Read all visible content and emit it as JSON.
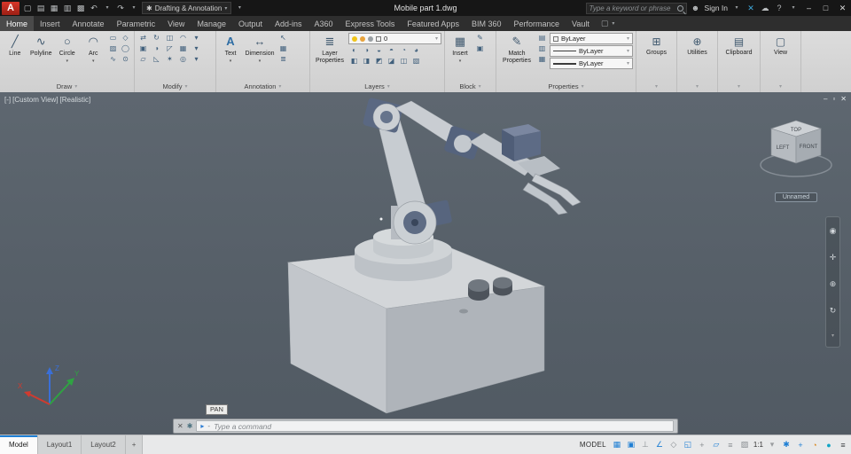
{
  "theme": {
    "titlebar_bg": "#161616",
    "ribbon_bg": "#d5d5d5",
    "viewport_bg": "#59626b",
    "accent_blue": "#1f7fd4",
    "autocad_red": "#c1271b",
    "model_gray": "#c8ccd0",
    "joint_dark": "#5a6880"
  },
  "titlebar": {
    "logo": "A",
    "workspace": "Drafting & Annotation",
    "doc_title": "Mobile part 1.dwg",
    "search_placeholder": "Type a keyword or phrase",
    "sign_in": "Sign In",
    "help": "?"
  },
  "ribbon_tabs": [
    "Home",
    "Insert",
    "Annotate",
    "Parametric",
    "View",
    "Manage",
    "Output",
    "Add-ins",
    "A360",
    "Express Tools",
    "Featured Apps",
    "BIM 360",
    "Performance",
    "Vault"
  ],
  "ribbon": {
    "draw": {
      "label": "Draw",
      "line": "Line",
      "polyline": "Polyline",
      "circle": "Circle",
      "arc": "Arc"
    },
    "modify": {
      "label": "Modify"
    },
    "annotation": {
      "label": "Annotation",
      "text": "Text",
      "dimension": "Dimension"
    },
    "layers": {
      "label": "Layers",
      "layer_properties": "Layer Properties",
      "current_layer": "0"
    },
    "block": {
      "label": "Block",
      "insert": "Insert"
    },
    "properties": {
      "label": "Properties",
      "match": "Match Properties",
      "bylayer": "ByLayer"
    },
    "groups": {
      "label": "Groups"
    },
    "utilities": {
      "label": "Utilities"
    },
    "clipboard": {
      "label": "Clipboard"
    },
    "view": {
      "label": "View"
    }
  },
  "viewport": {
    "controls": {
      "minimize": "[-]",
      "view": "[Custom View]",
      "style": "[Realistic]"
    },
    "viewcube": {
      "top": "TOP",
      "left": "LEFT",
      "front": "FRONT"
    },
    "view_name": "Unnamed",
    "tooltip": "PAN",
    "win": {
      "min": "‒",
      "restore": "▫",
      "close": "✕"
    }
  },
  "command": {
    "prompt": "▸",
    "dash": "-",
    "placeholder": "Type a command"
  },
  "statusbar": {
    "model_label": "MODEL",
    "scale": "1:1",
    "tabs": [
      "Model",
      "Layout1",
      "Layout2"
    ],
    "add_tab": "+"
  },
  "icons": {
    "caret": "▾",
    "new": "▢",
    "open": "▤",
    "save": "▦",
    "saveas": "▥",
    "plot": "▩",
    "undo": "↶",
    "redo": "↷",
    "gear": "✱",
    "person": "☻",
    "exchange": "✕",
    "cloud": "☁",
    "min": "–",
    "max": "□",
    "close": "✕",
    "line": "╱",
    "polyline": "∿",
    "circle": "○",
    "arc": "◠",
    "text": "A",
    "dimension": "↔",
    "leader": "↖",
    "table": "▦",
    "textstyle": "≣",
    "layerprops": "≣",
    "insert": "▦",
    "edit_block": "✎",
    "create_block": "▣",
    "match": "✎",
    "rect": "▭",
    "polygon": "◇",
    "hatch": "▨",
    "ellipse": "◯",
    "spline": "∿",
    "point": "⊙",
    "move": "⇄",
    "copy": "▣",
    "stretch": "▱",
    "rotate": "↻",
    "mirror": "◑",
    "scale": "◸",
    "trim": "◫",
    "fillet": "◠",
    "array": "▦",
    "erase": "◺",
    "explode": "✶",
    "offset": "◎",
    "groups": "⊞",
    "utilities": "⊕",
    "clipboard": "▤",
    "view": "▢",
    "l1": "◐",
    "l2": "◑",
    "l3": "◒",
    "l4": "◓",
    "l5": "◔",
    "l6": "◕",
    "l7": "◧",
    "l8": "◨",
    "l9": "◩",
    "l10": "◪",
    "l11": "◫",
    "l12": "▧",
    "p1": "▤",
    "p2": "▥",
    "p3": "▦",
    "nav_wheel": "◉",
    "nav_pan": "✛",
    "nav_zoom": "⊕",
    "nav_orbit": "↻",
    "grid": "▦",
    "snap": "▣",
    "ortho": "⊥",
    "polar": "∠",
    "iso": "◇",
    "osnap": "◱",
    "otrack": "+",
    "ducs": "▱",
    "lwt": "≡",
    "tpy": "▨",
    "isolate": "◔",
    "perf": "●",
    "menu": "≡",
    "plus": "+"
  }
}
